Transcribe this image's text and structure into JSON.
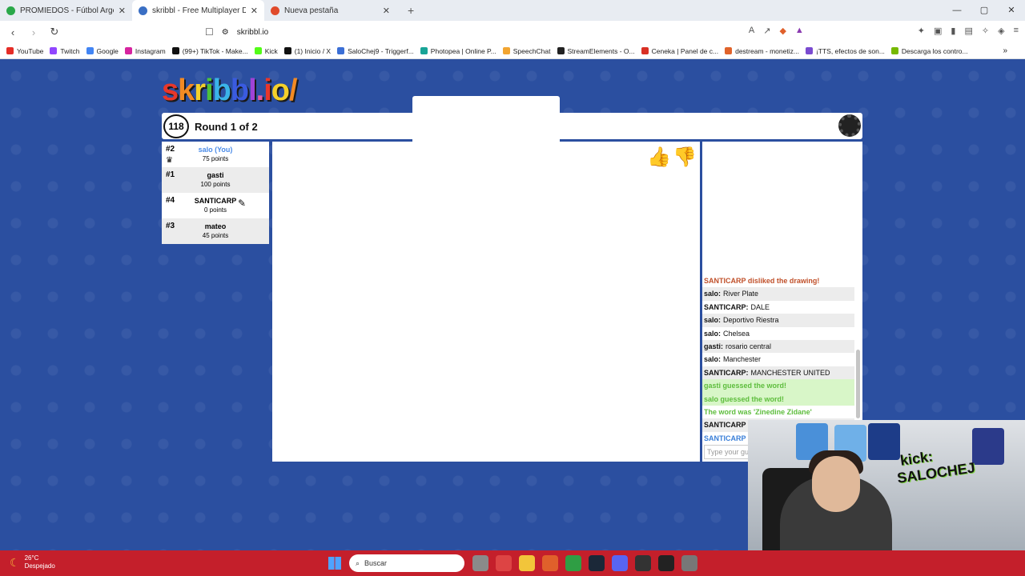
{
  "browser": {
    "tabs": [
      {
        "title": "PROMIEDOS - Fútbol Argentino",
        "color": "#2aa84a",
        "active": false
      },
      {
        "title": "skribbl - Free Multiplayer Dra",
        "color": "#3a6fc4",
        "active": true
      },
      {
        "title": "Nueva pestaña",
        "color": "#e04a2b",
        "active": false
      }
    ],
    "url": "skribbl.io",
    "bookmarks": [
      {
        "label": "YouTube",
        "color": "#e52d27"
      },
      {
        "label": "Twitch",
        "color": "#9146ff"
      },
      {
        "label": "Google",
        "color": "#4285f4"
      },
      {
        "label": "Instagram",
        "color": "#d6249f"
      },
      {
        "label": "(99+) TikTok - Make...",
        "color": "#111111"
      },
      {
        "label": "Kick",
        "color": "#53fc18"
      },
      {
        "label": "(1) Inicio / X",
        "color": "#111111"
      },
      {
        "label": "SaloChej9 - Triggerf...",
        "color": "#3b6fd6"
      },
      {
        "label": "Photopea | Online P...",
        "color": "#18a497"
      },
      {
        "label": "SpeechChat",
        "color": "#f2a531"
      },
      {
        "label": "StreamElements - O...",
        "color": "#222222"
      },
      {
        "label": "Ceneka | Panel de c...",
        "color": "#d93025"
      },
      {
        "label": "destream - monetiz...",
        "color": "#e0632b"
      },
      {
        "label": "¡TTS, efectos de son...",
        "color": "#7a4bd0"
      },
      {
        "label": "Descarga los contro...",
        "color": "#76b900"
      }
    ]
  },
  "game": {
    "timer": "118",
    "round_label": "Round 1 of 2",
    "players": [
      {
        "rank": "#2",
        "name": "salo (You)",
        "points": "75 points",
        "me": true,
        "crown": true,
        "avatar_color": "#f4c6a0"
      },
      {
        "rank": "#1",
        "name": "gasti",
        "points": "100 points",
        "me": false,
        "crown": false,
        "avatar_color": "#d32a2a"
      },
      {
        "rank": "#4",
        "name": "SANTICARP",
        "points": "0 points",
        "me": false,
        "crown": false,
        "avatar_color": "#4bb83a",
        "drawing": true
      },
      {
        "rank": "#3",
        "name": "mateo",
        "points": "45 points",
        "me": false,
        "crown": false,
        "avatar_color": "#d9262b"
      }
    ],
    "chat": [
      {
        "type": "red",
        "text": "SANTICARP disliked the drawing!"
      },
      {
        "type": "msg",
        "user": "salo:",
        "text": "River Plate"
      },
      {
        "type": "msg",
        "user": "SANTICARP:",
        "text": "DALE"
      },
      {
        "type": "msg",
        "user": "salo:",
        "text": "Deportivo Riestra"
      },
      {
        "type": "msg",
        "user": "salo:",
        "text": "Chelsea"
      },
      {
        "type": "msg",
        "user": "gasti:",
        "text": "rosario central"
      },
      {
        "type": "msg",
        "user": "salo:",
        "text": "Manchester"
      },
      {
        "type": "msg",
        "user": "SANTICARP:",
        "text": "MANCHESTER UNITED"
      },
      {
        "type": "green",
        "text": "gasti guessed the word!"
      },
      {
        "type": "green",
        "text": "salo guessed the word!"
      },
      {
        "type": "green2",
        "text": "The word was 'Zinedine Zidane'"
      },
      {
        "type": "msg",
        "user": "SANTICARP",
        "text": ""
      },
      {
        "type": "blue",
        "user": "SANTICARP",
        "text": ""
      }
    ],
    "chat_placeholder": "Type your gu"
  },
  "webcam": {
    "brand_line1": "kick:",
    "brand_line2": "SALOCHEJ"
  },
  "taskbar": {
    "temperature": "26°C",
    "weather": "Despejado",
    "search_placeholder": "Buscar"
  }
}
